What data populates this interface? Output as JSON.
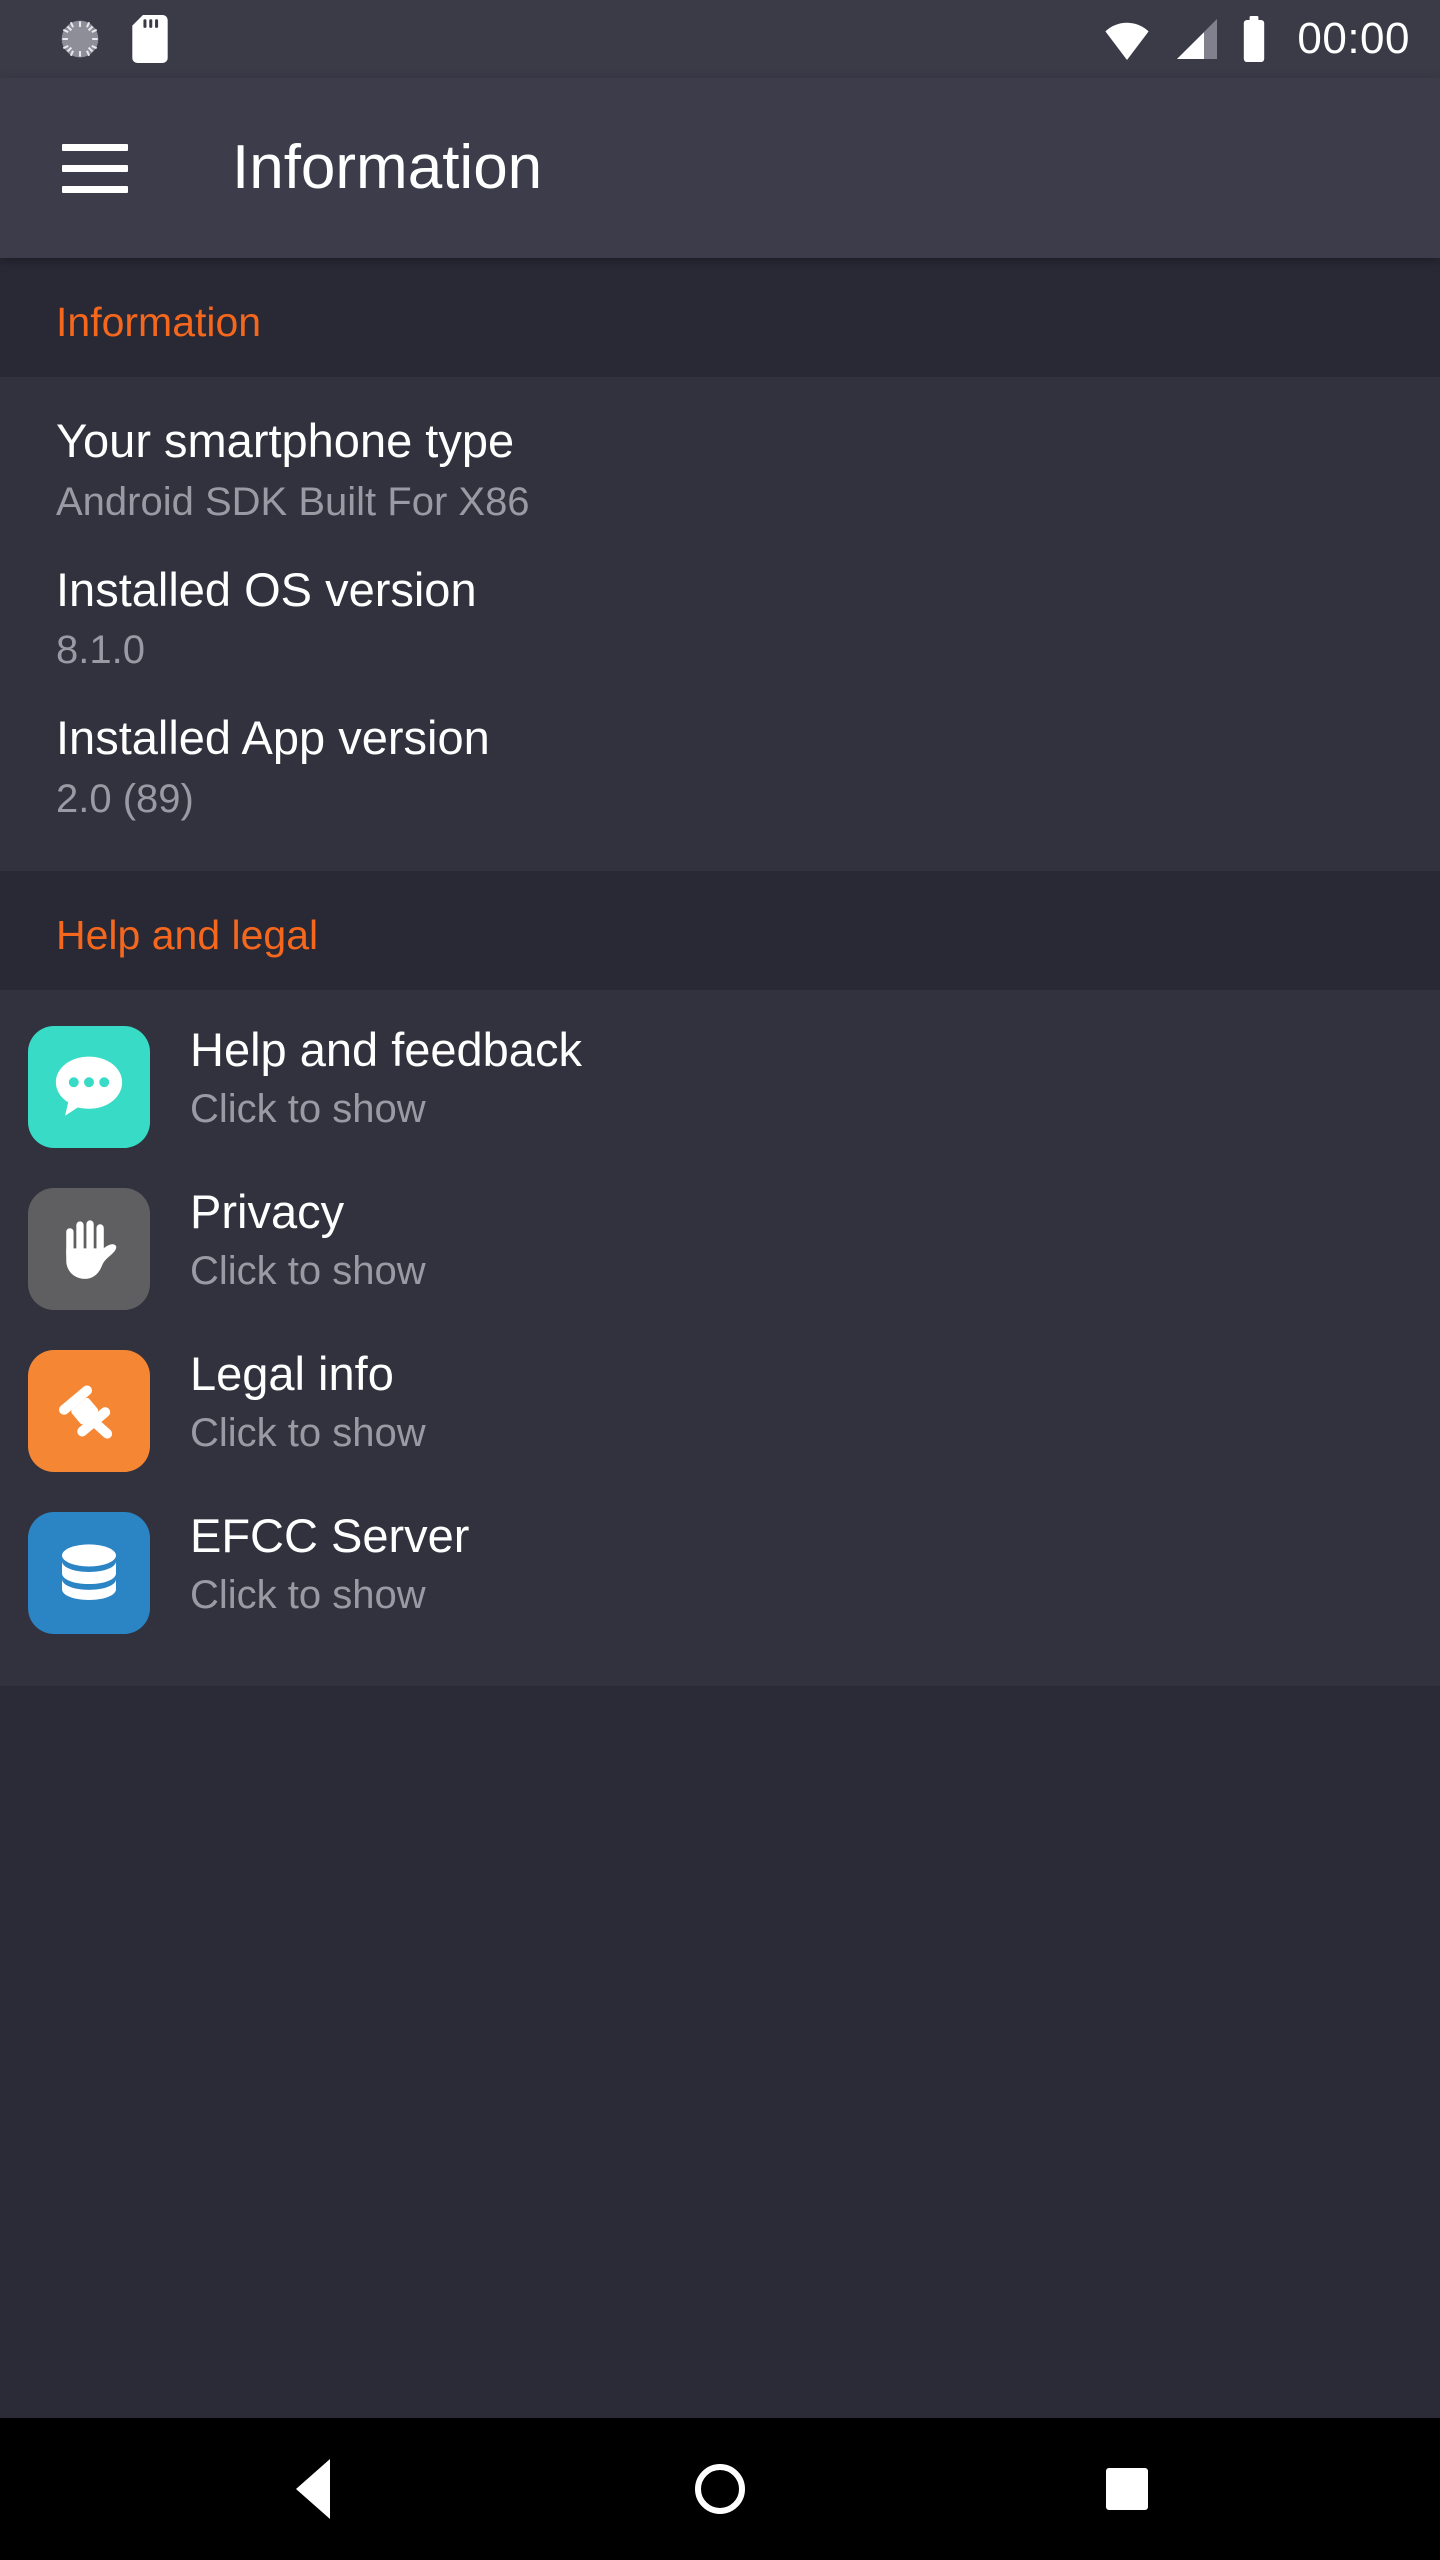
{
  "status_bar": {
    "icons_left": [
      "spinner-icon",
      "sd-card-icon"
    ],
    "icons_right": [
      "wifi-icon",
      "cellular-signal-icon",
      "battery-icon"
    ],
    "time": "00:00"
  },
  "app_bar": {
    "menu_icon": "hamburger-menu-icon",
    "title": "Information"
  },
  "sections": [
    {
      "header": "Information",
      "rows": [
        {
          "title": "Your smartphone type",
          "value": "Android SDK Built For X86"
        },
        {
          "title": "Installed OS version",
          "value": "8.1.0"
        },
        {
          "title": "Installed App version",
          "value": "2.0 (89)"
        }
      ]
    },
    {
      "header": "Help and legal",
      "items": [
        {
          "title": "Help and feedback",
          "subtitle": "Click to show",
          "icon": "chat-bubble-icon",
          "icon_bg": "#38dbc6"
        },
        {
          "title": "Privacy",
          "subtitle": "Click to show",
          "icon": "hand-stop-icon",
          "icon_bg": "#5f5f62"
        },
        {
          "title": "Legal info",
          "subtitle": "Click to show",
          "icon": "gavel-icon",
          "icon_bg": "#f58634"
        },
        {
          "title": "EFCC Server",
          "subtitle": "Click to show",
          "icon": "database-icon",
          "icon_bg": "#2b84c4"
        }
      ]
    }
  ],
  "nav_bar": {
    "back": "back-button",
    "home": "home-button",
    "recents": "recents-button"
  },
  "colors": {
    "accent": "#f4671c",
    "app_bar": "#3c3c4a",
    "status_bar": "#3b3b48",
    "page_bg": "#2a2b36",
    "row_bg": "#32323e",
    "section_bg": "#282935",
    "title_text": "#ffffff",
    "secondary_text": "#9a9aa4"
  }
}
